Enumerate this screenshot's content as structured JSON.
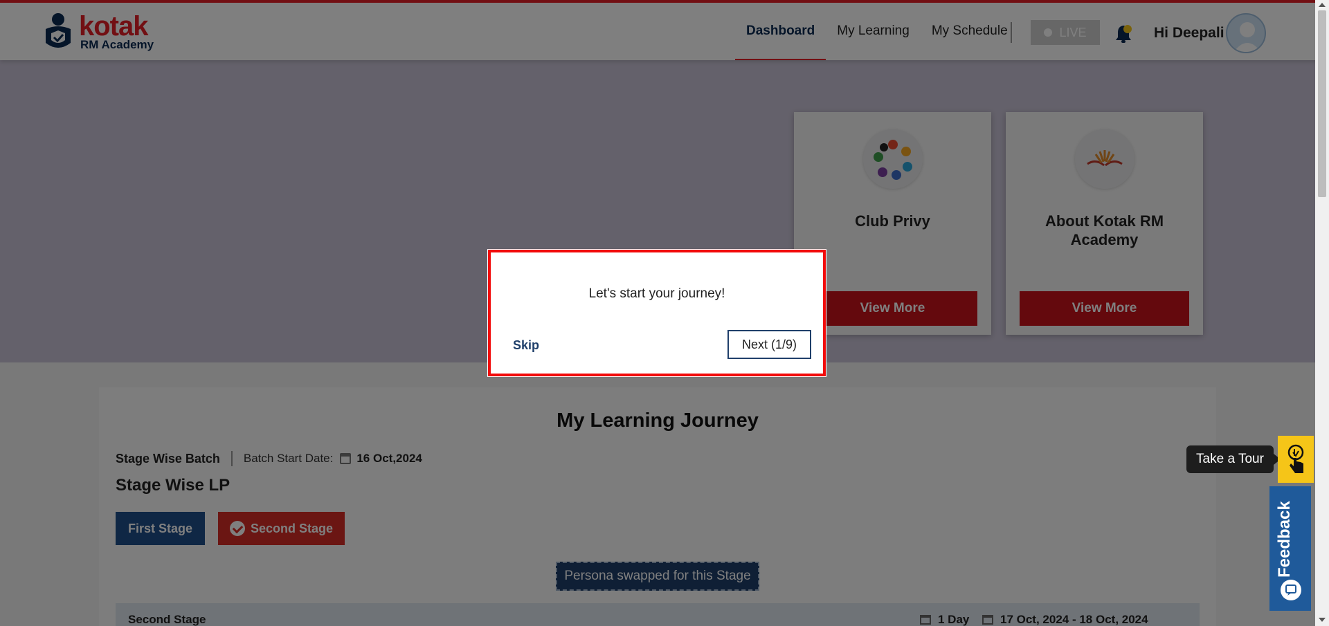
{
  "header": {
    "logo_text": "kotak",
    "logo_subtext": "RM Academy",
    "nav": [
      "Dashboard",
      "My Learning",
      "My Schedule"
    ],
    "live_label": "LIVE",
    "greeting": "Hi Deepali"
  },
  "cards": [
    {
      "title": "Club Privy",
      "button": "View More"
    },
    {
      "title": "About Kotak RM Academy",
      "button": "View More"
    }
  ],
  "journey": {
    "title": "My Learning Journey",
    "batch_name": "Stage Wise Batch",
    "batch_start_label": "Batch Start Date:",
    "batch_start_date": "16 Oct,2024",
    "lp_title": "Stage Wise LP",
    "stages": [
      "First Stage",
      "Second Stage"
    ],
    "persona_note": "Persona swapped for this Stage",
    "current_stage": {
      "name": "Second Stage",
      "duration": "1 Day",
      "dates": "17 Oct, 2024 - 18 Oct, 2024"
    }
  },
  "tour_popover": {
    "text": "Let's start your journey!",
    "skip_label": "Skip",
    "next_label": "Next (1/9)"
  },
  "floating": {
    "tour_tooltip": "Take a Tour",
    "feedback_label": "Feedback"
  },
  "colors": {
    "brand_red": "#e41e26",
    "navy": "#0b2a52",
    "button_red": "#c8121a",
    "stage_blue": "#1f4f8b",
    "tour_yellow": "#f5c518",
    "feedback_blue": "#1f5a9a"
  }
}
